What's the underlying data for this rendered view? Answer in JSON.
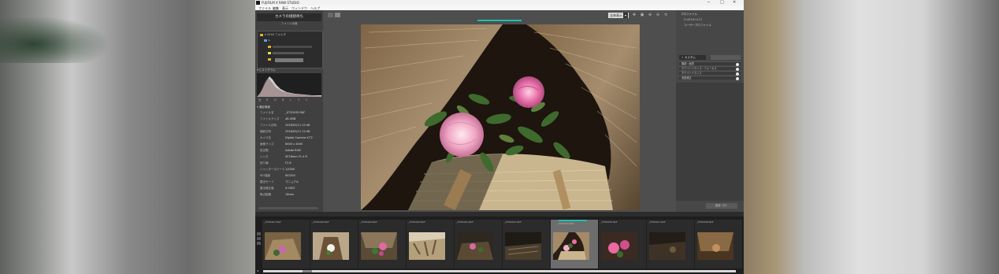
{
  "app": {
    "title": "FUJIFILM X RAW STUDIO",
    "window_controls": [
      "─",
      "□",
      "✕"
    ],
    "menu": [
      "ファイル",
      "編集",
      "表示",
      "ウィンドウ",
      "ヘルプ"
    ]
  },
  "left_panel": {
    "camera_button": "カメラの接続待ち",
    "camera_subtext": "ファイル待機",
    "tree": [
      {
        "label": "▾ 2018 フォルダ"
      },
      {
        "label": "▸ "
      },
      {
        "label": ""
      },
      {
        "label": ""
      }
    ],
    "histogram_header": "▾ ヒストグラム",
    "histogram_tabs": [
      "全",
      "R",
      "G",
      "B",
      "L",
      "Y",
      "C"
    ],
    "info_header": "▾ 撮影情報",
    "info": [
      {
        "key": "ファイル名",
        "value": "_XT2S435.RAF"
      },
      {
        "key": "ファイルサイズ",
        "value": "48.2MB"
      },
      {
        "key": "ファイル日時",
        "value": "2018/05/11 12:46"
      },
      {
        "key": "撮影日時",
        "value": "2018/05/11 12:46"
      },
      {
        "key": "カメラ名",
        "value": "Digital Camera X-T2"
      },
      {
        "key": "画像サイズ",
        "value": "6000 x 4000"
      },
      {
        "key": "色空間",
        "value": "Adobe RGB"
      },
      {
        "key": "レンズ",
        "value": "XF16mm F1.4 R"
      },
      {
        "key": "絞り値",
        "value": "F2.8"
      },
      {
        "key": "シャッタースピード",
        "value": "1/2000"
      },
      {
        "key": "ISO感度",
        "value": "ISO200"
      },
      {
        "key": "露出モード",
        "value": "マニュアル"
      },
      {
        "key": "露出補正値",
        "value": "0.00EV"
      },
      {
        "key": "焦点距離",
        "value": "16mm"
      }
    ]
  },
  "viewer": {
    "zoom_value": "全体表示",
    "zoom_arrow": "▾",
    "tool_icons": [
      "✥",
      "▣",
      "⊕",
      "⊖",
      "⟲"
    ]
  },
  "right_panel": {
    "header": "プロファイル",
    "selected": "FUJIFILM X-T2",
    "text": "ユーザープロファイル",
    "tab_active": "✓ カスタム",
    "panels": [
      "階調・画質",
      "ホワイトバランス・フォーカス",
      "ホワイトバランス",
      "収差補正"
    ],
    "bottom_button": "保存（S）"
  },
  "filmstrip": {
    "thumbs": [
      {
        "label": "_XT2S427.RAF"
      },
      {
        "label": "_XT2S428.RAF"
      },
      {
        "label": "_XT2S429.RAF"
      },
      {
        "label": "_XT2S430.RAF"
      },
      {
        "label": "_XT2S431.RAF"
      },
      {
        "label": "_XT2S432.RAF"
      },
      {
        "label": "_XT2S435.RAF"
      },
      {
        "label": "_XT2S436.RAF"
      },
      {
        "label": "_XT2S437.RAF"
      },
      {
        "label": "_XT2S438.RAF"
      }
    ],
    "selected_index": 6
  }
}
